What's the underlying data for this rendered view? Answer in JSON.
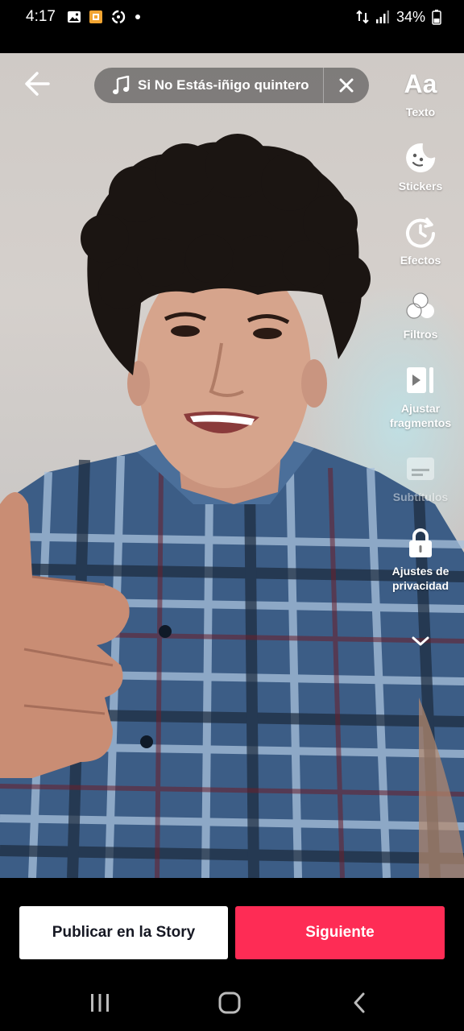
{
  "status_bar": {
    "time": "4:17",
    "left_icons": [
      "gallery-icon",
      "app-notification-icon",
      "sync-icon",
      "dot-icon"
    ],
    "right_icons": [
      "data-arrows-icon",
      "signal-icon",
      "battery-icon"
    ],
    "battery_percent": "34%"
  },
  "top_bar": {
    "back_icon": "arrow-left-icon",
    "sound": {
      "icon": "music-note-icon",
      "name": "Si No Estás-iñigo quintero",
      "close_icon": "close-icon"
    }
  },
  "tools": [
    {
      "key": "text",
      "glyph": "Aa",
      "label": "Texto",
      "icon": "text-aa-icon"
    },
    {
      "key": "stickers",
      "label": "Stickers",
      "icon": "sticker-icon"
    },
    {
      "key": "effects",
      "label": "Efectos",
      "icon": "effects-timer-icon"
    },
    {
      "key": "filters",
      "label": "Filtros",
      "icon": "filters-icon"
    },
    {
      "key": "adjust",
      "label_line1": "Ajustar",
      "label_line2": "fragmentos",
      "icon": "adjust-clips-icon"
    },
    {
      "key": "subtitles",
      "label": "Subtítulos",
      "icon": "subtitles-icon",
      "disabled": true
    },
    {
      "key": "privacy",
      "label_line1": "Ajustes de",
      "label_line2": "privacidad",
      "icon": "lock-icon"
    },
    {
      "key": "more",
      "icon": "chevron-down-icon"
    }
  ],
  "actions": {
    "story_label": "Publicar en la Story",
    "next_label": "Siguiente",
    "next_color": "#fe2c55"
  },
  "nav_bar": {
    "recents_icon": "recents-icon",
    "home_icon": "home-icon",
    "back_icon": "back-chevron-icon"
  }
}
